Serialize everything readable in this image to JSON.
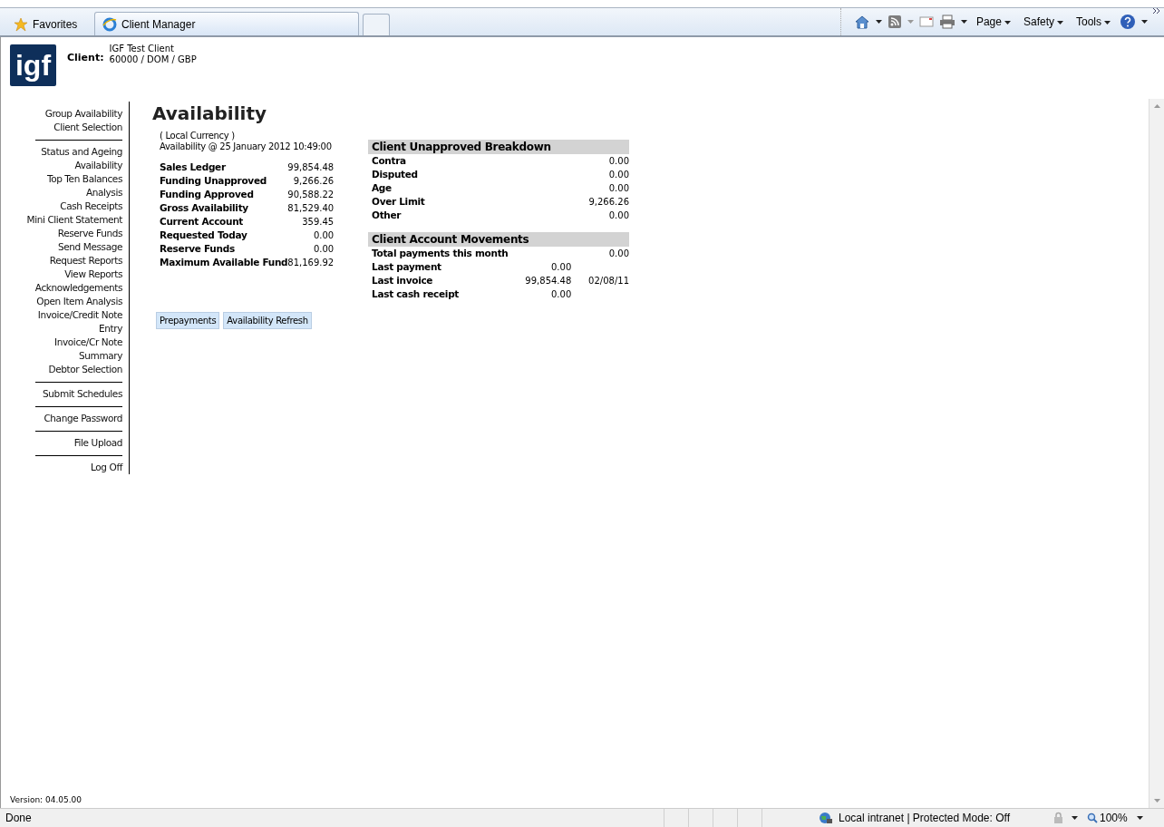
{
  "browser": {
    "favorites": "Favorites",
    "tabs": [
      {
        "label": "Client Manager",
        "selected": true
      }
    ],
    "menus": [
      "Page",
      "Safety",
      "Tools"
    ]
  },
  "header": {
    "logo": "igf",
    "client_label": "Client:",
    "client_name": "IGF Test Client",
    "client_code": "60000 / DOM / GBP"
  },
  "sidebar": {
    "groups": [
      [
        "Group Availability Client Selection"
      ],
      [
        "Status and Ageing Availability",
        "Top Ten Balances Analysis",
        "Cash Receipts",
        "Mini Client Statement",
        "Reserve Funds",
        "Send Message",
        "Request Reports",
        "View Reports",
        "Acknowledgements",
        "Open Item Analysis",
        "Invoice/Credit Note Entry",
        "Invoice/Cr Note Summary",
        "Debtor Selection"
      ],
      [
        "Submit Schedules"
      ],
      [
        "Change Password"
      ],
      [
        "File Upload"
      ],
      [
        "Log Off"
      ]
    ]
  },
  "main": {
    "title": "Availability",
    "currency": "( Local Currency )",
    "as_of": "Availability @ 25 January 2012 10:49:00",
    "summary": [
      {
        "label": "Sales Ledger",
        "value": "99,854.48"
      },
      {
        "label": "Funding Unapproved",
        "value": "9,266.26"
      },
      {
        "label": "Funding Approved",
        "value": "90,588.22"
      },
      {
        "label": "Gross Availability",
        "value": "81,529.40"
      },
      {
        "label": "Current Account",
        "value": "359.45"
      },
      {
        "label": "Requested Today",
        "value": "0.00"
      },
      {
        "label": "Reserve Funds",
        "value": "0.00"
      },
      {
        "label": "Maximum Available Fund",
        "value": "81,169.92"
      }
    ],
    "buttons": [
      "Prepayments",
      "Availability Refresh"
    ],
    "breakdown": {
      "title": "Client Unapproved Breakdown",
      "rows": [
        {
          "label": "Contra",
          "value": "0.00"
        },
        {
          "label": "Disputed",
          "value": "0.00"
        },
        {
          "label": "Age",
          "value": "0.00"
        },
        {
          "label": "Over Limit",
          "value": "9,266.26"
        },
        {
          "label": "Other",
          "value": "0.00"
        }
      ]
    },
    "movements": {
      "title": "Client Account Movements",
      "rows": [
        {
          "label": "Total payments this month",
          "total": "0.00"
        },
        {
          "label": "Last payment",
          "amount": "0.00"
        },
        {
          "label": "Last invoice",
          "amount": "99,854.48",
          "date": "02/08/11"
        },
        {
          "label": "Last cash receipt",
          "amount": "0.00"
        }
      ]
    },
    "version": "Version: 04.05.00"
  },
  "status_bar": {
    "text": "Done",
    "zone": "Local intranet | Protected Mode: Off",
    "zoom": "100%"
  }
}
